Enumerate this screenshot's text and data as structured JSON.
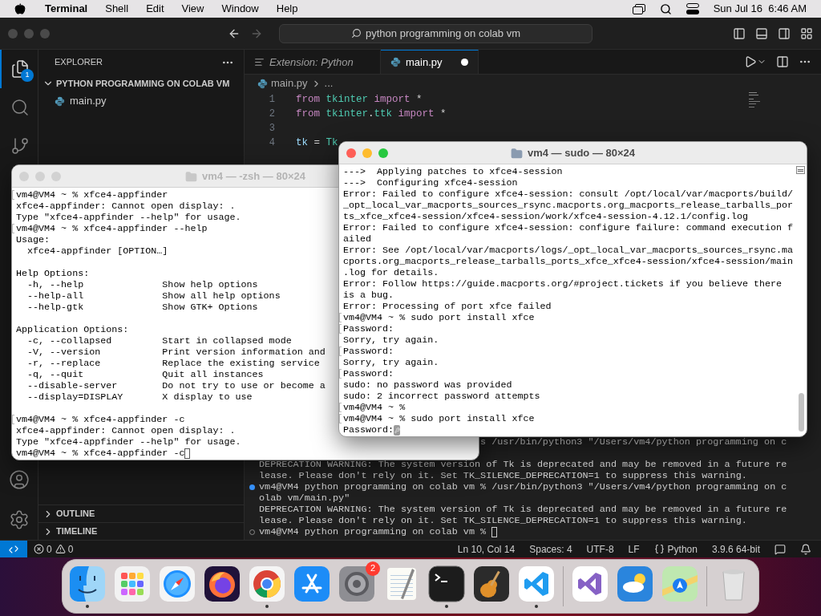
{
  "menu_bar": {
    "app": "Terminal",
    "items": [
      "Shell",
      "Edit",
      "View",
      "Window",
      "Help"
    ],
    "clock": "Sun Jul 16  6:46 AM"
  },
  "vscode": {
    "search": "python programming on colab vm",
    "activity": [
      {
        "kind": "explorer",
        "selected": true,
        "badge": "1"
      },
      {
        "kind": "search",
        "selected": false
      },
      {
        "kind": "source-control",
        "selected": false
      }
    ],
    "explorer": {
      "title": "EXPLORER",
      "folder": {
        "label": "PYTHON PROGRAMMING ON COLAB VM",
        "expanded": true,
        "children": [
          {
            "label": "main.py"
          }
        ]
      },
      "sections": [
        {
          "label": "OUTLINE",
          "expanded": false
        },
        {
          "label": "TIMELINE",
          "expanded": false
        }
      ]
    },
    "tabs": [
      {
        "label": "Extension: Python",
        "kind": "preview",
        "selected": false,
        "modified": false
      },
      {
        "label": "main.py",
        "kind": "python",
        "selected": true,
        "modified": true
      }
    ],
    "breadcrumb": [
      "main.py",
      "..."
    ],
    "code": [
      {
        "number": "1",
        "tokens": [
          {
            "text": "from",
            "kind": "keyword"
          },
          {
            "text": " tkinter",
            "kind": "module"
          },
          {
            "text": " import",
            "kind": "keyword"
          },
          {
            "text": " *",
            "kind": "plain"
          }
        ]
      },
      {
        "number": "2",
        "tokens": [
          {
            "text": "from",
            "kind": "keyword"
          },
          {
            "text": " tkinter",
            "kind": "module"
          },
          {
            "text": ".",
            "kind": "plain"
          },
          {
            "text": "ttk",
            "kind": "module"
          },
          {
            "text": " import",
            "kind": "keyword"
          },
          {
            "text": " *",
            "kind": "plain"
          }
        ]
      },
      {
        "number": "3"
      },
      {
        "number": "4",
        "tokens": [
          {
            "text": "tk",
            "kind": "variable"
          },
          {
            "text": " = ",
            "kind": "plain"
          },
          {
            "text": "Tk",
            "kind": "module"
          }
        ]
      }
    ],
    "terminal": [
      {
        "kind": "partial",
        "text": "s /usr/bin/python3 \"/Users/vm4/python programming on c"
      },
      {
        "kind": "blank"
      },
      {
        "kind": "plain",
        "text": "DEPRECATION WARNING: The system version of Tk is deprecated and may be removed in a future re"
      },
      {
        "kind": "plain",
        "text": "lease. Please don't rely on it. Set TK_SILENCE_DEPRECATION=1 to suppress this warning."
      },
      {
        "kind": "success",
        "text": "vm4@VM4 python programming on colab vm % /usr/bin/python3 \"/Users/vm4/python programming on c"
      },
      {
        "kind": "plain",
        "text": "olab vm/main.py\""
      },
      {
        "kind": "plain",
        "text": "DEPRECATION WARNING: The system version of Tk is deprecated and may be removed in a future re"
      },
      {
        "kind": "plain",
        "text": "lease. Please don't rely on it. Set TK_SILENCE_DEPRECATION=1 to suppress this warning."
      },
      {
        "kind": "idle",
        "text": "vm4@VM4 python programming on colab vm % ",
        "cursor": true
      }
    ]
  },
  "status_bar": {
    "errors": "0",
    "warnings": "0",
    "items": [
      {
        "kind": "plain",
        "text": "Ln 10, Col 14"
      },
      {
        "kind": "plain",
        "text": "Spaces: 4"
      },
      {
        "kind": "plain",
        "text": "UTF-8"
      },
      {
        "kind": "plain",
        "text": "LF"
      },
      {
        "kind": "language",
        "text": "Python"
      },
      {
        "kind": "plain",
        "text": "3.9.6 64-bit"
      }
    ]
  },
  "terminals": [
    {
      "title": "vm4 — -zsh — 80×24",
      "active": false,
      "lines": [
        {
          "kind": "text",
          "text": "vm4@VM4 ~ % xfce4-appfinder",
          "marked": true
        },
        {
          "kind": "text",
          "text": "xfce4-appfinder: Cannot open display: ."
        },
        {
          "kind": "text",
          "text": "Type \"xfce4-appfinder --help\" for usage."
        },
        {
          "kind": "text",
          "text": "vm4@VM4 ~ % xfce4-appfinder --help",
          "marked": true
        },
        {
          "kind": "text",
          "text": "Usage:"
        },
        {
          "kind": "text",
          "text": "  xfce4-appfinder [OPTION…]"
        },
        {
          "kind": "blank"
        },
        {
          "kind": "text",
          "text": "Help Options:"
        },
        {
          "kind": "text",
          "text": "  -h, --help              Show help options"
        },
        {
          "kind": "text",
          "text": "  --help-all              Show all help options"
        },
        {
          "kind": "text",
          "text": "  --help-gtk              Show GTK+ Options"
        },
        {
          "kind": "blank"
        },
        {
          "kind": "text",
          "text": "Application Options:"
        },
        {
          "kind": "text",
          "text": "  -c, --collapsed         Start in collapsed mode"
        },
        {
          "kind": "text",
          "text": "  -V, --version           Print version information and"
        },
        {
          "kind": "text",
          "text": "  -r, --replace           Replace the existing service"
        },
        {
          "kind": "text",
          "text": "  -q, --quit              Quit all instances"
        },
        {
          "kind": "text",
          "text": "  --disable-server        Do not try to use or become a"
        },
        {
          "kind": "text",
          "text": "  --display=DISPLAY       X display to use"
        },
        {
          "kind": "blank"
        },
        {
          "kind": "text",
          "text": "vm4@VM4 ~ % xfce4-appfinder -c",
          "marked": true
        },
        {
          "kind": "text",
          "text": "xfce4-appfinder: Cannot open display: ."
        },
        {
          "kind": "text",
          "text": "Type \"xfce4-appfinder --help\" for usage."
        },
        {
          "kind": "text",
          "text": "vm4@VM4 ~ % xfce4-appfinder -c",
          "cursor": true
        }
      ]
    },
    {
      "title": "vm4 — sudo — 80×24",
      "active": true,
      "lines": [
        {
          "kind": "text",
          "text": "--->  Applying patches to xfce4-session"
        },
        {
          "kind": "text",
          "text": "--->  Configuring xfce4-session"
        },
        {
          "kind": "text",
          "text": "Error: Failed to configure xfce4-session: consult /opt/local/var/macports/build/"
        },
        {
          "kind": "text",
          "text": "_opt_local_var_macports_sources_rsync.macports.org_macports_release_tarballs_por"
        },
        {
          "kind": "text",
          "text": "ts_xfce_xfce4-session/xfce4-session/work/xfce4-session-4.12.1/config.log"
        },
        {
          "kind": "text",
          "text": "Error: Failed to configure xfce4-session: configure failure: command execution f"
        },
        {
          "kind": "text",
          "text": "ailed"
        },
        {
          "kind": "text",
          "text": "Error: See /opt/local/var/macports/logs/_opt_local_var_macports_sources_rsync.ma"
        },
        {
          "kind": "text",
          "text": "cports.org_macports_release_tarballs_ports_xfce_xfce4-session/xfce4-session/main"
        },
        {
          "kind": "text",
          "text": ".log for details."
        },
        {
          "kind": "text",
          "text": "Error: Follow https://guide.macports.org/#project.tickets if you believe there"
        },
        {
          "kind": "text",
          "text": "is a bug."
        },
        {
          "kind": "text",
          "text": "Error: Processing of port xfce failed"
        },
        {
          "kind": "text",
          "text": "vm4@VM4 ~ % sudo port install xfce",
          "marked": true
        },
        {
          "kind": "text",
          "text": "Password:",
          "marked": true
        },
        {
          "kind": "text",
          "text": "Sorry, try again."
        },
        {
          "kind": "text",
          "text": "Password:",
          "marked": true
        },
        {
          "kind": "text",
          "text": "Sorry, try again."
        },
        {
          "kind": "text",
          "text": "Password:",
          "marked": true
        },
        {
          "kind": "text",
          "text": "sudo: no password was provided"
        },
        {
          "kind": "text",
          "text": "sudo: 2 incorrect password attempts"
        },
        {
          "kind": "text",
          "text": "vm4@VM4 ~ %",
          "marked": true
        },
        {
          "kind": "text",
          "text": "vm4@VM4 ~ % sudo port install xfce",
          "marked": true
        },
        {
          "kind": "secure-input",
          "text": "Password:",
          "cursor": true
        }
      ]
    }
  ],
  "dock": [
    {
      "kind": "finder",
      "running": true
    },
    {
      "kind": "launchpad",
      "running": false
    },
    {
      "kind": "safari",
      "running": false
    },
    {
      "kind": "firefox",
      "running": false
    },
    {
      "kind": "chrome",
      "running": true
    },
    {
      "kind": "appstore",
      "running": false
    },
    {
      "kind": "settings",
      "running": false,
      "badge": "2"
    },
    {
      "kind": "textedit",
      "running": false
    },
    {
      "kind": "terminal",
      "running": true
    },
    {
      "kind": "garageband",
      "running": false
    },
    {
      "kind": "vscode",
      "running": true
    },
    {
      "kind": "separator"
    },
    {
      "kind": "visualstudio",
      "running": false
    },
    {
      "kind": "weather",
      "running": false
    },
    {
      "kind": "maps",
      "running": false
    },
    {
      "kind": "separator"
    },
    {
      "kind": "trash",
      "running": false
    }
  ]
}
